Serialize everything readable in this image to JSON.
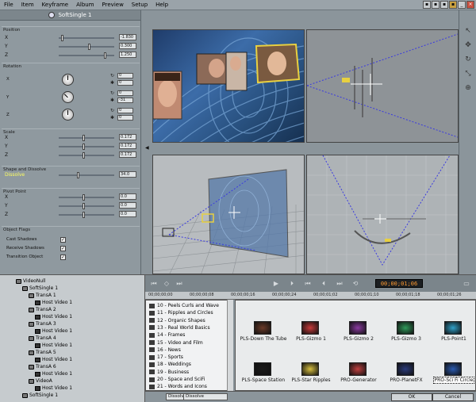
{
  "menubar": {
    "items": [
      "File",
      "Item",
      "Keyframe",
      "Album",
      "Preview",
      "Setup",
      "Help"
    ]
  },
  "left_panel": {
    "title": "SoftSingle 1",
    "position": {
      "header": "Position",
      "rows": [
        {
          "label": "X",
          "value": "-1.830",
          "slider": 0.05
        },
        {
          "label": "Y",
          "value": "0.300",
          "slider": 0.55
        },
        {
          "label": "Z",
          "value": "1.250",
          "slider": 0.85
        }
      ]
    },
    "rotation": {
      "header": "Rotation",
      "rows": [
        {
          "label": "X",
          "values": [
            "0",
            "0"
          ]
        },
        {
          "label": "Y",
          "values": [
            "0",
            "-31"
          ]
        },
        {
          "label": "Z",
          "values": [
            "0",
            "0"
          ]
        }
      ]
    },
    "scale": {
      "header": "Scale",
      "rows": [
        {
          "label": "X",
          "value": "0.172",
          "slider": 0.45
        },
        {
          "label": "Y",
          "value": "0.172",
          "slider": 0.45
        },
        {
          "label": "Z",
          "value": "0.172",
          "slider": 0.45
        }
      ]
    },
    "shape": {
      "header": "Shape and Dissolve",
      "rows": [
        {
          "label": "Dissolve",
          "value": "34.0",
          "slider": 0.35
        }
      ]
    },
    "pivot": {
      "header": "Pivot Point",
      "rows": [
        {
          "label": "X",
          "value": "0.0",
          "slider": 0.45
        },
        {
          "label": "Y",
          "value": "0.0",
          "slider": 0.45
        },
        {
          "label": "Z",
          "value": "0.0",
          "slider": 0.45
        }
      ]
    },
    "flags": {
      "header": "Object Flags",
      "items": [
        {
          "label": "Cast Shadows",
          "checked": true
        },
        {
          "label": "Receive Shadows",
          "checked": true
        },
        {
          "label": "Transition Object",
          "checked": true
        }
      ]
    }
  },
  "tree": {
    "nodes": [
      {
        "label": "VideoNull",
        "indent": 0,
        "icon": "folder"
      },
      {
        "label": "SoftSingle 1",
        "indent": 1,
        "icon": "folder"
      },
      {
        "label": "TransA 1",
        "indent": 2,
        "icon": "folder"
      },
      {
        "label": "Host Video 1",
        "indent": 3,
        "icon": "film"
      },
      {
        "label": "TransA 2",
        "indent": 2,
        "icon": "folder"
      },
      {
        "label": "Host Video 1",
        "indent": 3,
        "icon": "film"
      },
      {
        "label": "TransA 3",
        "indent": 2,
        "icon": "folder"
      },
      {
        "label": "Host Video 1",
        "indent": 3,
        "icon": "film"
      },
      {
        "label": "TransA 4",
        "indent": 2,
        "icon": "folder"
      },
      {
        "label": "Host Video 1",
        "indent": 3,
        "icon": "film"
      },
      {
        "label": "TransA 5",
        "indent": 2,
        "icon": "folder"
      },
      {
        "label": "Host Video 1",
        "indent": 3,
        "icon": "film"
      },
      {
        "label": "TransA 6",
        "indent": 2,
        "icon": "folder"
      },
      {
        "label": "Host Video 1",
        "indent": 3,
        "icon": "film"
      },
      {
        "label": "VideoA",
        "indent": 2,
        "icon": "folder"
      },
      {
        "label": "Host Video 1",
        "indent": 3,
        "icon": "film"
      },
      {
        "label": "SoftSingle 1",
        "indent": 1,
        "icon": "folder"
      }
    ]
  },
  "transport": {
    "timecode": "00;00;01;06"
  },
  "timeline": {
    "ticks": [
      "00;00;00;00",
      "00;00;00;08",
      "00;00;00;16",
      "00;00;00;24",
      "00;00;01;02",
      "00;00;01;10",
      "00;00;01;18",
      "00;00;01;26"
    ]
  },
  "categories": [
    "10 - Peels Curls and Wave",
    "11 - Ripples and Circles",
    "12 - Organic Shapes",
    "13 - Real World Basics",
    "14 - Frames",
    "15 - Video and Film",
    "16 - News",
    "17 - Sports",
    "18 - Weddings",
    "19 - Business",
    "20 - Space and SciFi",
    "21 - Words and Icons"
  ],
  "gallery": {
    "items": [
      {
        "label": "PLS-Down The Tube",
        "color": "#6b3a28"
      },
      {
        "label": "PLS-Gizmo 1",
        "color": "#c83a3a"
      },
      {
        "label": "PLS-Gizmo 2",
        "color": "#8a3aa0"
      },
      {
        "label": "PLS-Gizmo 3",
        "color": "#2f9a5a"
      },
      {
        "label": "PLS-Point1",
        "color": "#2fa0c8"
      },
      {
        "label": "PLS-Space Station",
        "color": "#1a1a1a"
      },
      {
        "label": "PLS-Star Ripples",
        "color": "#d8c040"
      },
      {
        "label": "PRO-Generator",
        "color": "#c04040"
      },
      {
        "label": "PRO-PlanetFX",
        "color": "#2a3a7a"
      },
      {
        "label": "PRO-Sci Fi Circle",
        "color": "#2a5ab0"
      }
    ],
    "selected_index": 9
  },
  "statusbar": {
    "field1": "Dissolve",
    "field2": "Dissolve",
    "ok": "OK",
    "cancel": "Cancel"
  }
}
